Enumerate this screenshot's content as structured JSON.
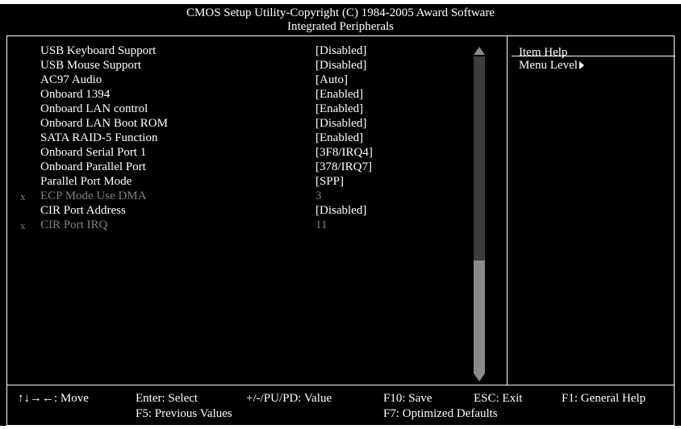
{
  "header": {
    "title_line1": "CMOS Setup Utility-Copyright (C) 1984-2005 Award Software",
    "title_line2": "Integrated Peripherals"
  },
  "items": [
    {
      "label": "USB Keyboard Support",
      "value": "[Disabled]",
      "disabled": false,
      "x_mark": ""
    },
    {
      "label": "USB Mouse Support",
      "value": "[Disabled]",
      "disabled": false,
      "x_mark": ""
    },
    {
      "label": "AC97 Audio",
      "value": "[Auto]",
      "disabled": false,
      "x_mark": ""
    },
    {
      "label": "Onboard 1394",
      "value": "[Enabled]",
      "disabled": false,
      "x_mark": ""
    },
    {
      "label": "Onboard LAN control",
      "value": "[Enabled]",
      "disabled": false,
      "x_mark": ""
    },
    {
      "label": "Onboard LAN Boot ROM",
      "value": "[Disabled]",
      "disabled": false,
      "x_mark": ""
    },
    {
      "label": "SATA RAID-5 Function",
      "value": "[Enabled]",
      "disabled": false,
      "x_mark": ""
    },
    {
      "label": "Onboard Serial Port 1",
      "value": "[3F8/IRQ4]",
      "disabled": false,
      "x_mark": ""
    },
    {
      "label": "Onboard Parallel Port",
      "value": "[378/IRQ7]",
      "disabled": false,
      "x_mark": ""
    },
    {
      "label": "Parallel Port Mode",
      "value": "[SPP]",
      "disabled": false,
      "x_mark": ""
    },
    {
      "label": "ECP Mode Use DMA",
      "value": "3",
      "disabled": true,
      "x_mark": "x"
    },
    {
      "label": "CIR Port Address",
      "value": "[Disabled]",
      "disabled": false,
      "x_mark": ""
    },
    {
      "label": "CIR Port IRQ",
      "value": "11",
      "disabled": true,
      "x_mark": "x"
    }
  ],
  "help_panel": {
    "title": "Item Help",
    "menu_level": "Menu Level"
  },
  "footer": {
    "move": "↑↓→←: Move",
    "enter": "Enter: Select",
    "value": "+/-/PU/PD: Value",
    "f10": "F10: Save",
    "esc": "ESC: Exit",
    "f1": "F1: General Help",
    "f5": "F5: Previous Values",
    "f7": "F7: Optimized Defaults"
  },
  "colors": {
    "background": "#000000",
    "text": "#ffffff",
    "disabled_text": "#808080",
    "scrollbar": "#8a8a8a"
  }
}
